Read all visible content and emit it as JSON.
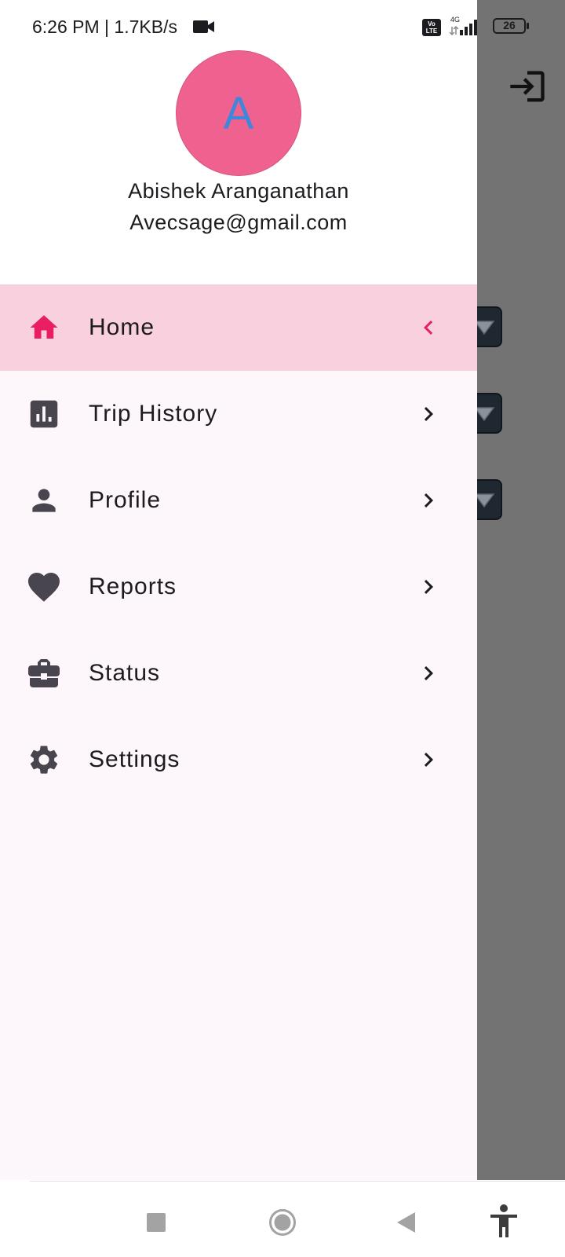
{
  "status_bar": {
    "time": "6:26 PM | 1.7KB/s",
    "network_label": "Vo LTE",
    "network_type": "4G",
    "battery": "26",
    "icons": [
      "video-camera-icon",
      "volte-icon",
      "signal-icon",
      "battery-icon"
    ]
  },
  "drawer": {
    "avatar_letter": "A",
    "user_name": "Abishek Aranganathan",
    "user_email": "Avecsage@gmail.com",
    "items": [
      {
        "label": "Home",
        "icon": "home-icon",
        "active": true
      },
      {
        "label": "Trip History",
        "icon": "bar-chart-icon",
        "active": false
      },
      {
        "label": "Profile",
        "icon": "person-icon",
        "active": false
      },
      {
        "label": "Reports",
        "icon": "heart-icon",
        "active": false
      },
      {
        "label": "Status",
        "icon": "briefcase-icon",
        "active": false
      },
      {
        "label": "Settings",
        "icon": "gear-icon",
        "active": false
      }
    ]
  },
  "colors": {
    "accent": "#e91e63",
    "active_bg": "#f8d0de",
    "avatar_bg": "#ef6290",
    "avatar_letter": "#3d88dc",
    "icon": "#49454f",
    "drawer_bg": "#fdf7fc",
    "scrim": "#737373"
  },
  "nav_bar": {
    "buttons": [
      "recents-square-icon",
      "home-circle-icon",
      "back-triangle-icon",
      "accessibility-icon"
    ]
  }
}
